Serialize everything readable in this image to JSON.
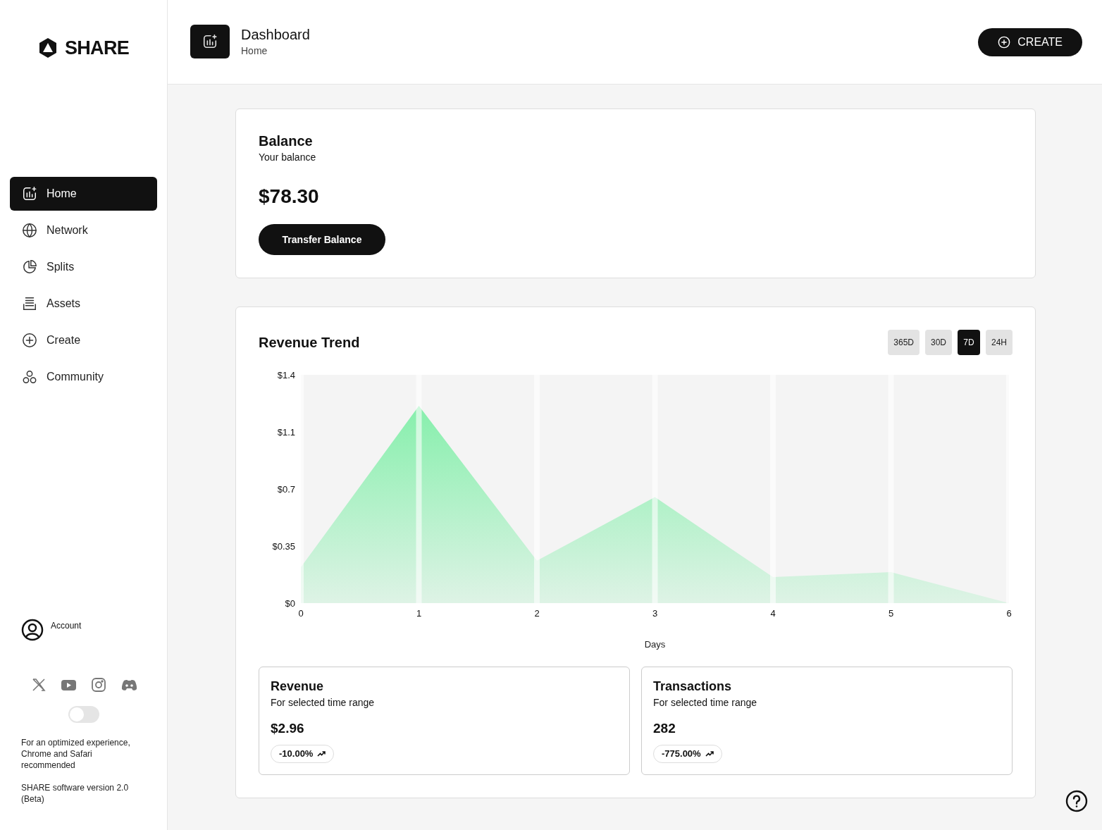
{
  "sidebar": {
    "logo": "SHARE",
    "nav": [
      {
        "label": "Home",
        "kind": "chart",
        "selected": true
      },
      {
        "label": "Network",
        "kind": "globe",
        "selected": false
      },
      {
        "label": "Splits",
        "kind": "pie",
        "selected": false
      },
      {
        "label": "Assets",
        "kind": "stack",
        "selected": false
      },
      {
        "label": "Create",
        "kind": "plus",
        "selected": false
      },
      {
        "label": "Community",
        "kind": "circles",
        "selected": false
      }
    ],
    "account": "Account",
    "theme_toggle": {
      "on": false
    },
    "note": "For an optimized experience, Chrome and Safari recommended",
    "version": "SHARE software version 2.0 (Beta)"
  },
  "header": {
    "title": "Dashboard",
    "breadcrumb": "Home",
    "create_button": "CREATE"
  },
  "balance": {
    "title": "Balance",
    "subtitle": "Your balance",
    "amount": "$78.30",
    "button": "Transfer Balance"
  },
  "revenue_trend": {
    "title": "Revenue Trend",
    "ranges": [
      {
        "label": "365D",
        "selected": false
      },
      {
        "label": "30D",
        "selected": false
      },
      {
        "label": "7D",
        "selected": true
      },
      {
        "label": "24H",
        "selected": false
      }
    ],
    "chart_data": {
      "type": "area",
      "xlabel": "Days",
      "x": [
        0,
        1,
        2,
        3,
        4,
        5,
        6
      ],
      "series": [
        {
          "color": "#86efac",
          "values": [
            0.22,
            1.21,
            0.26,
            0.65,
            0.16,
            0.19,
            0
          ]
        }
      ],
      "xticks": [
        0,
        1,
        2,
        3,
        4,
        5,
        6
      ],
      "xlim": [
        0,
        6
      ],
      "ylim": [
        0,
        1.4
      ],
      "grid": true,
      "yticks": [
        {
          "value": 0,
          "label": "$0"
        },
        {
          "value": 0.35,
          "label": "$0.35"
        },
        {
          "value": 0.7,
          "label": "$0.7"
        },
        {
          "value": 1.05,
          "label": "$1.1"
        },
        {
          "value": 1.4,
          "label": "$1.4"
        }
      ]
    }
  },
  "stats": [
    {
      "title": "Revenue",
      "subtitle": "For selected time range",
      "value": "$2.96",
      "change": "-10.00%"
    },
    {
      "title": "Transactions",
      "subtitle": "For selected time range",
      "value": "282",
      "change": "-775.00%"
    }
  ]
}
